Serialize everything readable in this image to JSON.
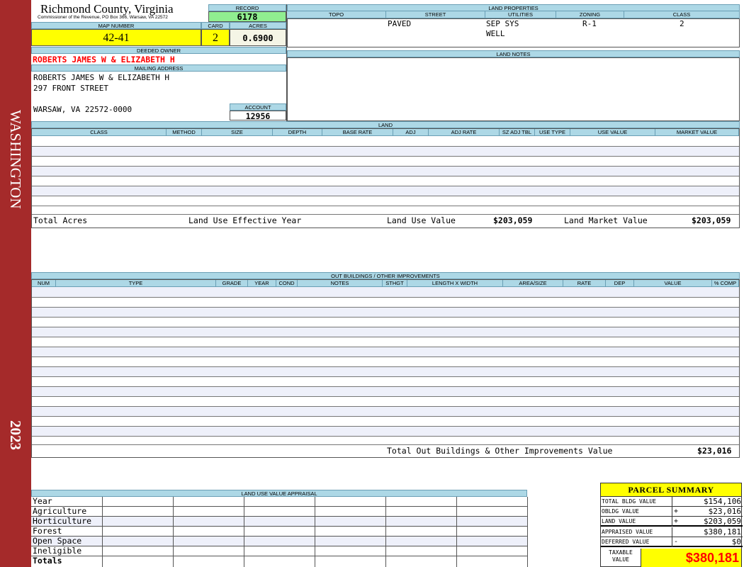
{
  "sidebar": {
    "county": "WASHINGTON",
    "year": "2023"
  },
  "header": {
    "title": "Richmond County, Virginia",
    "subtitle": "Commissioner of the Revenue, PO Box 366, Warsaw, VA 22572",
    "record_label": "RECORD",
    "record_value": "6178",
    "map_label": "MAP NUMBER",
    "map_value": "42-41",
    "card_label": "CARD",
    "card_value": "2",
    "acres_label": "ACRES",
    "acres_value": "0.6900",
    "deeded_owner_label": "DEEDED OWNER",
    "deeded_owner_value": "ROBERTS JAMES W & ELIZABETH H",
    "mailing_label": "MAILING ADDRESS",
    "mailing_line1": "ROBERTS JAMES W & ELIZABETH H",
    "mailing_line2": "297 FRONT STREET",
    "mailing_line3": "WARSAW, VA 22572-0000",
    "account_label": "ACCOUNT",
    "account_value": "12956"
  },
  "land_properties": {
    "title": "LAND PROPERTIES",
    "columns": [
      "TOPO",
      "STREET",
      "UTILITIES",
      "ZONING",
      "CLASS"
    ],
    "topo": "",
    "street": "PAVED",
    "utilities_1": "SEP SYS",
    "utilities_2": "WELL",
    "zoning": "R-1",
    "class": "2"
  },
  "land_notes": {
    "title": "LAND NOTES"
  },
  "land": {
    "title": "LAND",
    "columns": [
      "CLASS",
      "METHOD",
      "SIZE",
      "DEPTH",
      "BASE RATE",
      "ADJ",
      "ADJ RATE",
      "SZ ADJ TBL",
      "USE TYPE",
      "USE VALUE",
      "MARKET VALUE"
    ],
    "total_acres_label": "Total Acres",
    "effective_year_label": "Land Use Effective Year",
    "use_value_label": "Land Use Value",
    "use_value": "$203,059",
    "market_value_label": "Land Market Value",
    "market_value": "$203,059"
  },
  "outbuildings": {
    "title": "OUT BUILDINGS / OTHER IMPROVEMENTS",
    "columns": [
      "NUM",
      "TYPE",
      "GRADE",
      "YEAR",
      "COND",
      "NOTES",
      "STHGT",
      "LENGTH X WIDTH",
      "AREA/SIZE",
      "RATE",
      "DEP",
      "VALUE",
      "% COMP"
    ],
    "total_label": "Total Out Buildings & Other Improvements Value",
    "total_value": "$23,016"
  },
  "land_use_appraisal": {
    "title": "LAND USE VALUE APPRAISAL",
    "rows": [
      "Year",
      "Agriculture",
      "Horticulture",
      "Forest",
      "Open Space",
      "Ineligible",
      "Totals"
    ]
  },
  "parcel_summary": {
    "title": "PARCEL SUMMARY",
    "rows": [
      {
        "label": "TOTAL BLDG VALUE",
        "sign": "",
        "value": "$154,106"
      },
      {
        "label": "OBLDG VALUE",
        "sign": "+",
        "value": "$23,016"
      },
      {
        "label": "LAND VALUE",
        "sign": "+",
        "value": "$203,059"
      },
      {
        "label": "APPRAISED VALUE",
        "sign": "",
        "value": "$380,181"
      },
      {
        "label": "DEFERRED VALUE",
        "sign": "-",
        "value": "$0"
      }
    ],
    "taxable_label_1": "TAXABLE",
    "taxable_label_2": "VALUE",
    "taxable_value": "$380,181"
  },
  "colors": {
    "sidebar": "#a52a2a",
    "header_blue": "#add8e6",
    "highlight_yellow": "#ffff00",
    "record_green": "#90ee90",
    "owner_red": "#ff0000"
  }
}
